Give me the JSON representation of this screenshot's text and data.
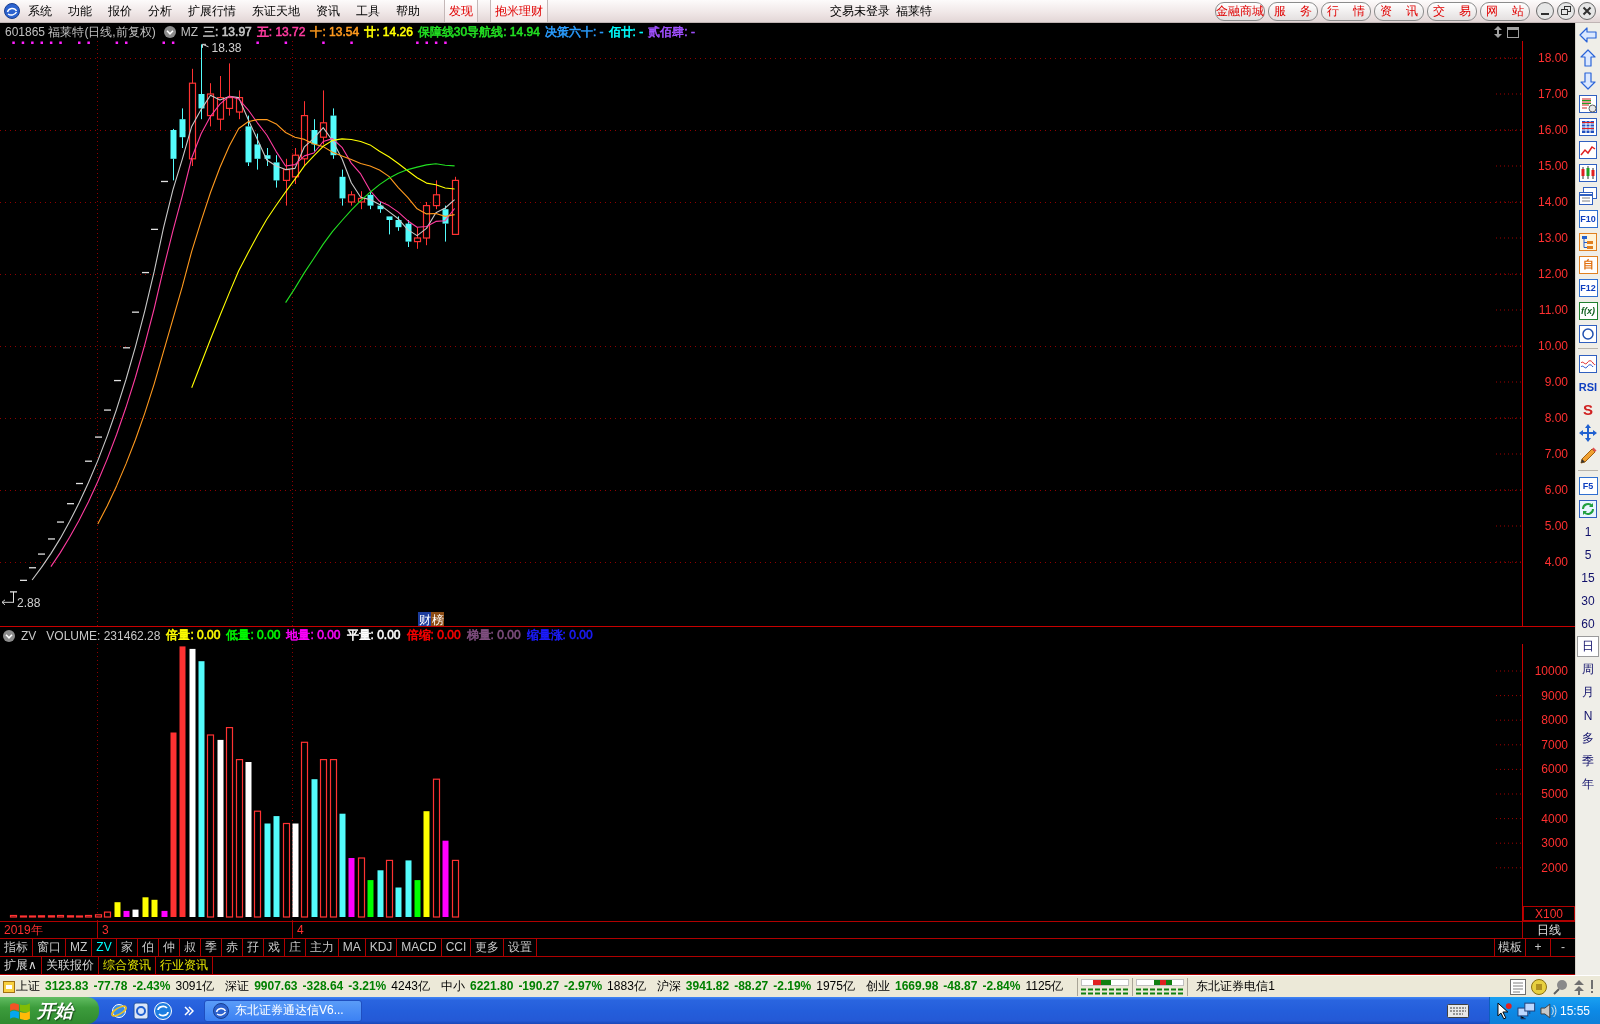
{
  "menu_bar": {
    "items": [
      "系统",
      "功能",
      "报价",
      "分析",
      "扩展行情",
      "东证天地",
      "资讯",
      "工具",
      "帮助"
    ],
    "highlight_items": [
      "发现",
      "抱米理财"
    ],
    "login_status": "交易未登录",
    "stock_name": "福莱特",
    "service_buttons": [
      "金融商城",
      "服 务",
      "行 情",
      "资 讯",
      "交 易",
      "网 站"
    ]
  },
  "price_chart": {
    "title": "601865 福莱特(日线,前复权)",
    "indicator": "MZ",
    "legend": [
      {
        "text": "三: 13.97",
        "color": "#c8c8c8"
      },
      {
        "text": "五: 13.72",
        "color": "#ff3ca0"
      },
      {
        "text": "十: 13.54",
        "color": "#ff9a1e"
      },
      {
        "text": "廿: 14.26",
        "color": "#ffff00"
      },
      {
        "text": "保障线30导航线: 14.94",
        "color": "#22e022"
      },
      {
        "text": "决策六十: -",
        "color": "#2a9dff"
      },
      {
        "text": "佰廿: -",
        "color": "#00ffff"
      },
      {
        "text": "贰佰肆: -",
        "color": "#a050ff"
      }
    ],
    "high_label": "18.38",
    "low_label": "2.88",
    "event_tags": [
      {
        "text": "财",
        "color": "#1c3c9c"
      },
      {
        "text": "榜",
        "color": "#8c4c14"
      }
    ],
    "axis_labels": [
      "18.00",
      "17.00",
      "16.00",
      "15.00",
      "14.00",
      "13.00",
      "12.00",
      "11.00",
      "10.00",
      "9.00",
      "8.00",
      "7.00",
      "6.00",
      "5.00",
      "4.00"
    ]
  },
  "volume_chart": {
    "indicator": "ZV",
    "volume": "VOLUME: 231462.28",
    "legend": [
      {
        "text": "倍量: 0.00",
        "color": "#ffff00"
      },
      {
        "text": "低量: 0.00",
        "color": "#00ff00"
      },
      {
        "text": "地量: 0.00",
        "color": "#ff00ff"
      },
      {
        "text": "平量: 0.00",
        "color": "#ffffff"
      },
      {
        "text": "倍缩: 0.00",
        "color": "#ff0000"
      },
      {
        "text": "梯量: 0.00",
        "color": "#804f80"
      },
      {
        "text": "缩量涨: 0.00",
        "color": "#1c1cff"
      }
    ],
    "axis_labels": [
      "10000",
      "9000",
      "8000",
      "7000",
      "6000",
      "5000",
      "4000",
      "3000",
      "2000"
    ],
    "unit": "X100"
  },
  "date_row": {
    "labels": [
      "2019年",
      "3",
      "4"
    ],
    "period": "日线"
  },
  "indicator_tabs": {
    "tabs": [
      {
        "label": "指标",
        "selected": false
      },
      {
        "label": "窗口",
        "selected": false
      },
      {
        "label": "MZ",
        "selected": false
      },
      {
        "label": "ZV",
        "selected": true
      },
      {
        "label": "家",
        "selected": false
      },
      {
        "label": "伯",
        "selected": false
      },
      {
        "label": "仲",
        "selected": false
      },
      {
        "label": "叔",
        "selected": false
      },
      {
        "label": "季",
        "selected": false
      },
      {
        "label": "赤",
        "selected": false
      },
      {
        "label": "孖",
        "selected": false
      },
      {
        "label": "戏",
        "selected": false
      },
      {
        "label": "庄",
        "selected": false
      },
      {
        "label": "主力",
        "selected": false
      },
      {
        "label": "MA",
        "selected": false
      },
      {
        "label": "KDJ",
        "selected": false
      },
      {
        "label": "MACD",
        "selected": false
      },
      {
        "label": "CCI",
        "selected": false
      },
      {
        "label": "更多",
        "selected": false
      },
      {
        "label": "设置",
        "selected": false
      }
    ],
    "actions": [
      "模板",
      "+",
      "-"
    ]
  },
  "info_tabs": [
    {
      "label": "扩展∧",
      "highlighted": false
    },
    {
      "label": "关联报价",
      "highlighted": false
    },
    {
      "label": "综合资讯",
      "highlighted": true
    },
    {
      "label": "行业资讯",
      "highlighted": true
    }
  ],
  "right_toolbar": {
    "labeled_tools": [
      "F10",
      "自",
      "F12",
      "f(x)",
      "RSI",
      "S",
      "F5"
    ],
    "periods": [
      {
        "label": "1",
        "selected": false
      },
      {
        "label": "5",
        "selected": false
      },
      {
        "label": "15",
        "selected": false
      },
      {
        "label": "30",
        "selected": false
      },
      {
        "label": "60",
        "selected": false
      },
      {
        "label": "日",
        "selected": true
      },
      {
        "label": "周",
        "selected": false
      },
      {
        "label": "月",
        "selected": false
      },
      {
        "label": "N",
        "selected": false
      },
      {
        "label": "多",
        "selected": false
      },
      {
        "label": "季",
        "selected": false
      },
      {
        "label": "年",
        "selected": false
      }
    ]
  },
  "status_bar": {
    "indices": [
      {
        "name": "上证",
        "value": "3123.83",
        "change": "-77.78",
        "percent": "-2.43%",
        "amount": "3091亿"
      },
      {
        "name": "深证",
        "value": "9907.63",
        "change": "-328.64",
        "percent": "-3.21%",
        "amount": "4243亿"
      },
      {
        "name": "中小",
        "value": "6221.80",
        "change": "-190.27",
        "percent": "-2.97%",
        "amount": "1883亿"
      },
      {
        "name": "沪深",
        "value": "3941.82",
        "change": "-88.27",
        "percent": "-2.19%",
        "amount": "1975亿"
      },
      {
        "name": "创业",
        "value": "1669.98",
        "change": "-48.87",
        "percent": "-2.84%",
        "amount": "1125亿"
      }
    ],
    "server": "东北证券电信1"
  },
  "taskbar": {
    "start": "开始",
    "task": "东北证券通达信V6...",
    "clock": "15:55"
  }
}
